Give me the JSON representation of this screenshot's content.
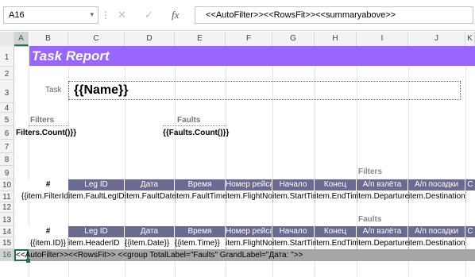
{
  "formula_bar": {
    "name_box": "A16",
    "name_dropdown": "▾",
    "separator": "⋮",
    "cancel_icon": "✕",
    "enter_icon": "✓",
    "fx_label": "fx",
    "formula": "<<AutoFilter>><<RowsFit>><<summaryabove>>"
  },
  "columns": [
    "A",
    "B",
    "C",
    "D",
    "E",
    "F",
    "G",
    "H",
    "I",
    "J",
    "K"
  ],
  "rows": [
    "1",
    "2",
    "3",
    "4",
    "5",
    "6",
    "7",
    "8",
    "9",
    "10",
    "11",
    "12",
    "13",
    "14",
    "15",
    "16"
  ],
  "report": {
    "title": "Task Report",
    "task_label": "Task",
    "task_value": "{{Name}}",
    "filters_label": "Filters",
    "filters_count": "Filters.Count()}}",
    "faults_label": "Faults",
    "faults_count": "{{Faults.Count()}}"
  },
  "table1": {
    "section_label": "Filters",
    "headers": [
      "#",
      "Leg ID",
      "Дата",
      "Время",
      "Номер рейса",
      "Начало",
      "Конец",
      "А/п взлёта",
      "А/п посадки",
      "С"
    ],
    "row": [
      "{{item.FilterId",
      "item.FaultLegID",
      "item.FaultDate",
      "item.FaultTime",
      "item.FlightNo",
      "item.StartTime",
      "item.EndTime",
      "item.Departure",
      "item.Destination",
      ""
    ]
  },
  "table2": {
    "section_label": "Faults",
    "headers": [
      "#",
      "Leg ID",
      "Дата",
      "Время",
      "Номер рейса",
      "Начало",
      "Конец",
      "А/п взлёта",
      "А/п посадки",
      "С"
    ],
    "row": [
      "{{item.ID}}",
      "item.HeaderID",
      "{{item.Date}}",
      "{{item.Time}}",
      "item.FlightNo",
      "item.StartTime",
      "item.EndTime",
      "item.Departure",
      "item.Destination",
      ""
    ]
  },
  "row16_text": "<<AutoFilter>><<RowsFit>> <<group TotalLabel=\"Faults\" GrandLabel=\"Дата: \">>",
  "colors": {
    "title_bar": "#9966ff",
    "table_header": "#6b6b91",
    "selected_row": "#a6a6a6"
  }
}
